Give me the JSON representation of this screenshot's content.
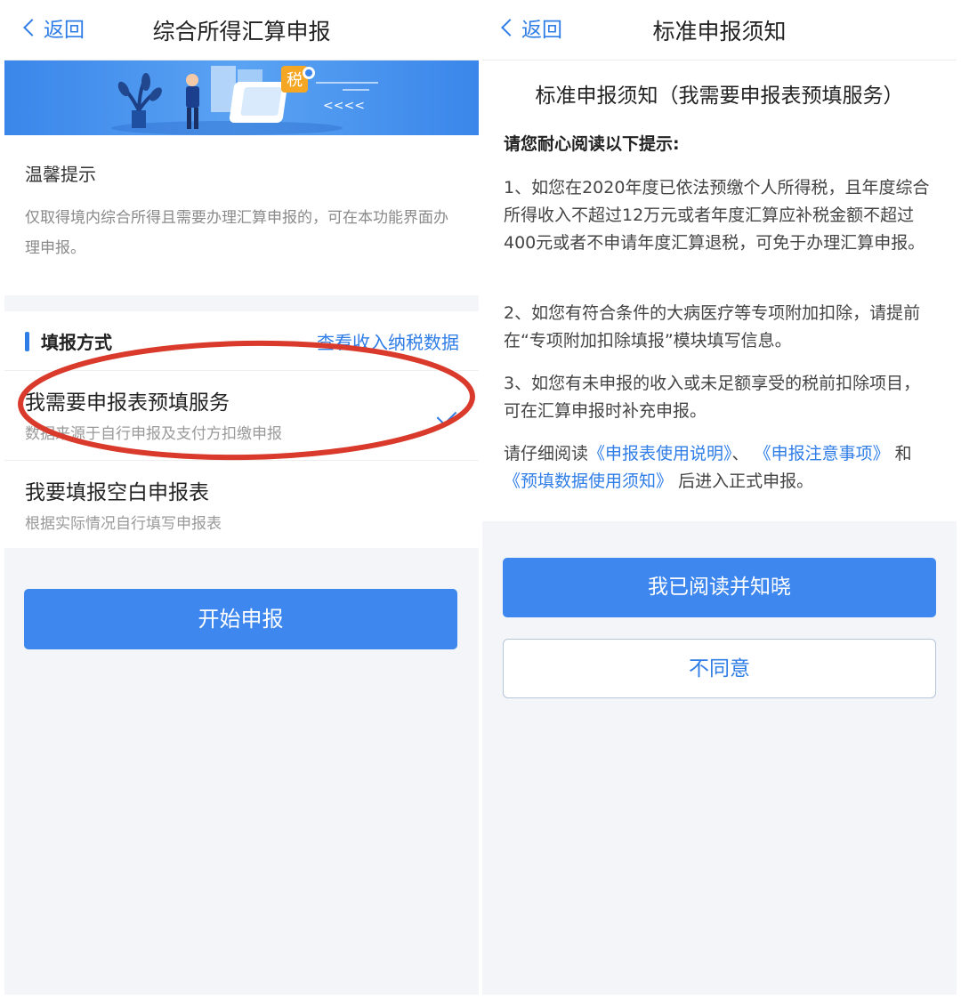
{
  "left": {
    "back_label": "返回",
    "title": "综合所得汇算申报",
    "banner": {
      "tax_badge": "税",
      "arrows": "<<<<"
    },
    "tip": {
      "title": "温馨提示",
      "text": "仅取得境内综合所得且需要办理汇算申报的，可在本功能界面办理申报。"
    },
    "method": {
      "section_title": "填报方式",
      "view_link": "查看收入纳税数据",
      "options": [
        {
          "title": "我需要申报表预填服务",
          "subtitle": "数据来源于自行申报及支付方扣缴申报",
          "selected": true
        },
        {
          "title": "我要填报空白申报表",
          "subtitle": "根据实际情况自行填写申报表",
          "selected": false
        }
      ]
    },
    "start_button": "开始申报"
  },
  "right": {
    "back_label": "返回",
    "title": "标准申报须知",
    "doc_title": "标准申报须知（我需要申报表预填服务）",
    "heading": "请您耐心阅读以下提示:",
    "items": [
      "1、如您在2020年度已依法预缴个人所得税，且年度综合所得收入不超过12万元或者年度汇算应补税金额不超过400元或者不申请年度汇算退税，可免于办理汇算申报。",
      "2、如您有符合条件的大病医疗等专项附加扣除，请提前在“专项附加扣除填报”模块填写信息。",
      "3、如您有未申报的收入或未足额享受的税前扣除项目，可在汇算申报时补充申报。"
    ],
    "read_notice": {
      "prefix": "请仔细阅读",
      "link1": "《申报表使用说明》",
      "sep1": "、",
      "link2": "《申报注意事项》",
      "sep2": "和",
      "link3": "《预填数据使用须知》",
      "suffix": "后进入正式申报。"
    },
    "agree_button": "我已阅读并知晓",
    "disagree_button": "不同意"
  },
  "colors": {
    "accent": "#2f7de6",
    "button": "#3d87ef",
    "annotation": "#d93a2b"
  }
}
